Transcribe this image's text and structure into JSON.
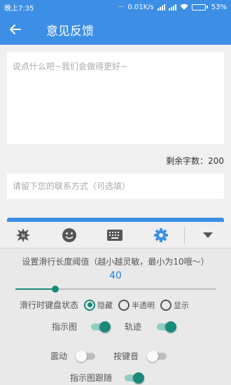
{
  "status_bar": {
    "time": "晚上7:35",
    "dots": "···",
    "network_speed": "0.01K/s",
    "battery": "53%",
    "battery_level": 0.53
  },
  "app_bar": {
    "title": "意见反馈",
    "back_icon": "arrow-left-icon"
  },
  "feedback": {
    "placeholder": "说点什么吧~我们会做得更好~",
    "value": "",
    "remaining_label": "剩余字数：200"
  },
  "contact": {
    "placeholder": "请留下您的联系方式（可选填）",
    "value": ""
  },
  "keyboard_toolbar": {
    "tools": [
      "logo-icon",
      "emoji-icon",
      "keyboard-icon",
      "gear-icon",
      "chevron-down-icon"
    ],
    "active_tool": "gear-icon"
  },
  "keyboard_settings": {
    "slide_title": "设置滑行长度阈值（越小越灵敏，最小为10哦～）",
    "slide_value": "40",
    "slide_fraction": 0.2,
    "keyboard_state_label": "滑行时键盘状态",
    "keyboard_state_options": [
      "隐藏",
      "半透明",
      "显示"
    ],
    "keyboard_state_selected": "隐藏",
    "indicator_label": "指示图",
    "indicator_on": true,
    "trail_label": "轨迹",
    "trail_on": true,
    "vibrate_label": "震动",
    "vibrate_on": false,
    "key_sound_label": "按键音",
    "key_sound_on": false,
    "follow_label": "指示图跟随",
    "follow_on": true
  },
  "colors": {
    "primary": "#3d8fe6",
    "accent": "#1a8a7a",
    "background": "#f0f0f0"
  }
}
